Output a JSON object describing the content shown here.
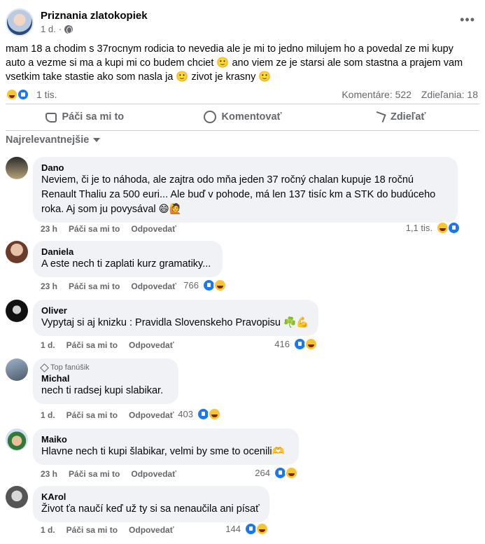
{
  "post": {
    "page_name": "Priznania zlatokopiek",
    "time": "1 d.",
    "text": "mam 18 a chodim s 37rocnym rodicia to nevedia ale je mi to jedno milujem ho a povedal ze mi kupy auto a vezme si ma a kupi mi co budem chciet 🙂 ano viem ze je starsi ale som stastna a prajem vam vsetkim take stastie ako som nasla ja 🙂 zivot je krasny 🙂",
    "reactions_count": "1 tis.",
    "comments_label": "Komentáre: 522",
    "shares_label": "Zdieľania: 18"
  },
  "actions": {
    "like": "Páči sa mi to",
    "comment": "Komentovať",
    "share": "Zdieľať"
  },
  "sort_label": "Najrelevantnejšie",
  "comments": [
    {
      "name": "Dano",
      "badge": "",
      "text": "Neviem, či je to náhoda, ale zajtra odo mňa jeden 37 ročný chalan kupuje 18 ročnú Renault Thaliu za 500 euri... Ale buď v pohode, má len 137 tisíc km a STK do budúceho roka. Aj som ju povysával 😄🙋",
      "time": "23 h",
      "like": "Páči sa mi to",
      "reply": "Odpovedať",
      "reactions": "1,1 tis."
    },
    {
      "name": "Daniela",
      "badge": "",
      "text": "A este nech ti zaplati kurz gramatiky...",
      "time": "23 h",
      "like": "Páči sa mi to",
      "reply": "Odpovedať",
      "reactions": "766"
    },
    {
      "name": "Oliver",
      "badge": "",
      "text": "Vypytaj si aj knizku : Pravidla Slovenskeho Pravopisu ☘️💪",
      "time": "1 d.",
      "like": "Páči sa mi to",
      "reply": "Odpovedať",
      "reactions": "416"
    },
    {
      "name": "Michal",
      "badge": "Top fanúšik",
      "text": "nech ti radsej kupi slabikar.",
      "time": "1 d.",
      "like": "Páči sa mi to",
      "reply": "Odpovedať",
      "reactions": "403"
    },
    {
      "name": "Maiko",
      "badge": "",
      "text": "Hlavne nech ti kupi šlabikar, velmi by sme to ocenili🫶",
      "time": "23 h",
      "like": "Páči sa mi to",
      "reply": "Odpovedať",
      "reactions": "264"
    },
    {
      "name": "KArol",
      "badge": "",
      "text": "Život ťa naučí keď už ty si sa nenaučila ani písať",
      "time": "1 d.",
      "like": "Páči sa mi to",
      "reply": "Odpovedať",
      "reactions": "144"
    }
  ],
  "colors": {
    "accent": "#1877f2",
    "muted": "#65676b",
    "bubble": "#f0f2f5"
  }
}
